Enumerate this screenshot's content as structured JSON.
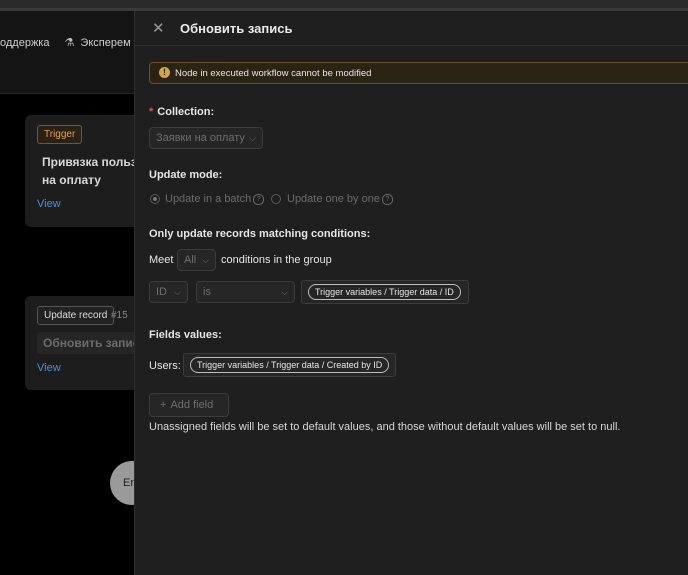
{
  "background": {
    "nav": {
      "support_label": "оддержка",
      "experiments_label": "Эксперем"
    },
    "trigger_node": {
      "tag": "Trigger",
      "title_line1": "Привязка пользо",
      "title_line2": "на оплату",
      "view_label": "View"
    },
    "update_node": {
      "tag": "Update record",
      "number": "#15",
      "input_value": "Обновить запись",
      "view_label": "View"
    },
    "end_label": "En"
  },
  "drawer": {
    "title": "Обновить запись",
    "alert": {
      "icon": "warning-icon",
      "text": "Node in executed workflow cannot be modified"
    },
    "collection": {
      "label": "Collection:",
      "required_mark": "*",
      "value": "Заявки на оплату"
    },
    "update_mode": {
      "label": "Update mode:",
      "options": [
        {
          "label": "Update in a batch",
          "selected": true
        },
        {
          "label": "Update one by one",
          "selected": false
        }
      ]
    },
    "conditions": {
      "label": "Only update records matching conditions:",
      "meet_prefix": "Meet",
      "meet_value": "All",
      "meet_suffix": "conditions in the group",
      "field_value": "ID",
      "operator_value": "is",
      "variable": "Trigger variables / Trigger data / ID"
    },
    "fields_values": {
      "label": "Fields values:",
      "field_label": "Users:",
      "variable": "Trigger variables / Trigger data / Created by ID"
    },
    "add_field_label": "Add field",
    "hint": "Unassigned fields will be set to default values, and those without default values will be set to null."
  },
  "colors": {
    "accent_link": "#4a90d9",
    "warning": "#d9a441",
    "required": "#e05050"
  }
}
